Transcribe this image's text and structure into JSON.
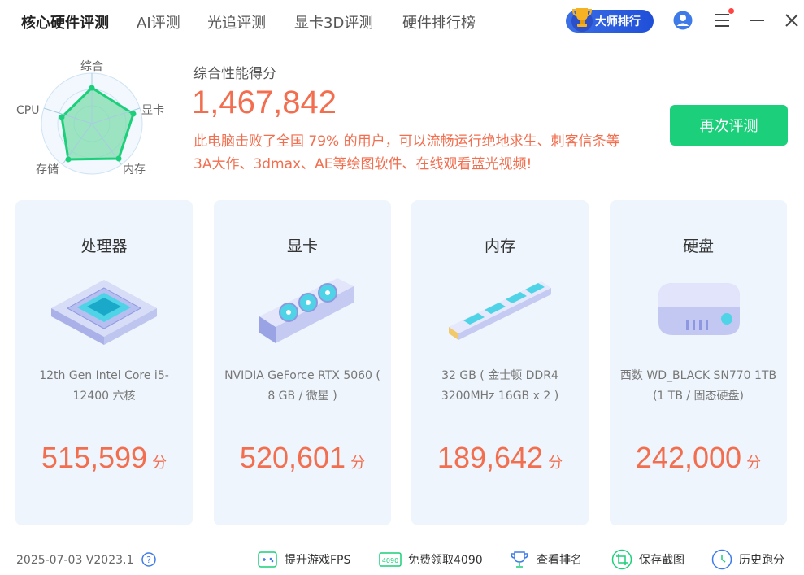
{
  "nav": {
    "tabs": [
      "核心硬件评测",
      "AI评测",
      "光追评测",
      "显卡3D评测",
      "硬件排行榜"
    ],
    "master_label": "大师排行"
  },
  "radar": {
    "labels": {
      "top": "综合",
      "right": "显卡",
      "bottom_right": "内存",
      "bottom_left": "存储",
      "left": "CPU"
    },
    "accent": "#1ccf7a"
  },
  "score": {
    "label": "综合性能得分",
    "value": "1,467,842",
    "desc_line1": "此电脑击败了全国 79% 的用户，可以流畅运行绝地求生、刺客信条等",
    "desc_line2": "3A大作、3dmax、AE等绘图软件、在线观看蓝光视频!",
    "retest_label": "再次评测"
  },
  "cards": [
    {
      "title": "处理器",
      "desc": "12th Gen Intel Core i5-12400 六核",
      "score": "515,599",
      "unit": "分"
    },
    {
      "title": "显卡",
      "desc": "NVIDIA GeForce RTX 5060 ( 8 GB / 微星 )",
      "score": "520,601",
      "unit": "分"
    },
    {
      "title": "内存",
      "desc": "32 GB ( 金士顿 DDR4 3200MHz 16GB x 2 )",
      "score": "189,642",
      "unit": "分"
    },
    {
      "title": "硬盘",
      "desc": "西数 WD_BLACK SN770 1TB (1 TB / 固态硬盘)",
      "score": "242,000",
      "unit": "分"
    }
  ],
  "footer": {
    "version": "2025-07-03 V2023.1",
    "items": [
      "提升游戏FPS",
      "免费领取4090",
      "查看排名",
      "保存截图",
      "历史跑分"
    ]
  },
  "colors": {
    "score": "#f26e4f",
    "primary": "#1ccf7a",
    "card_bg": "#eef5fc"
  }
}
